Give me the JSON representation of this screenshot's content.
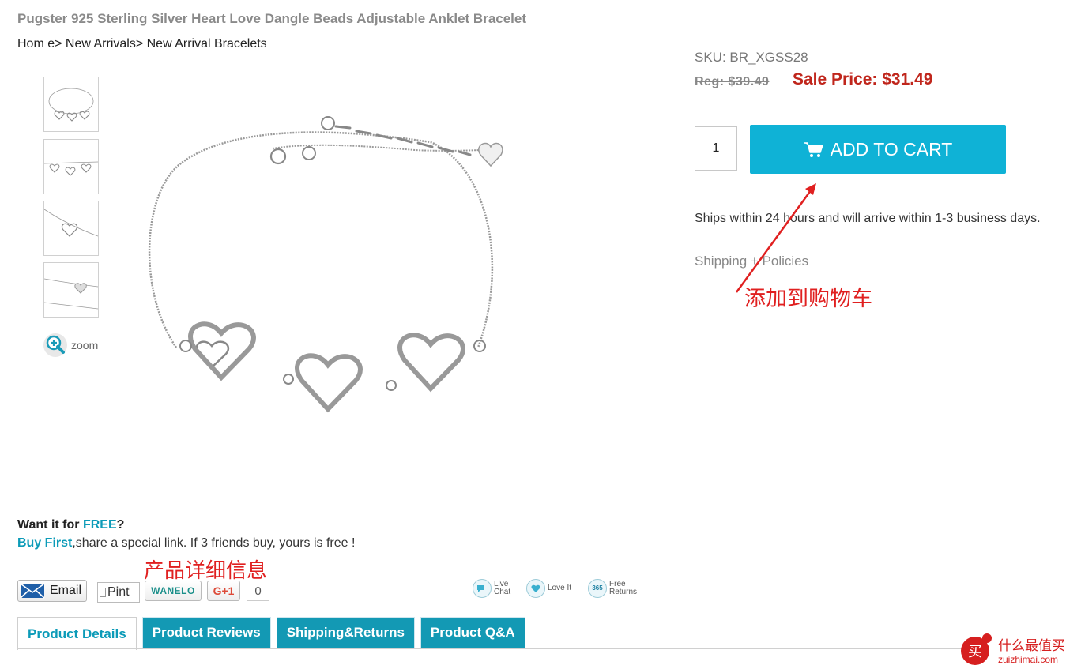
{
  "product": {
    "title": "Pugster 925 Sterling Silver Heart Love Dangle Beads Adjustable Anklet Bracelet",
    "sku": "SKU: BR_XGSS28",
    "reg_price": "Reg: $39.49",
    "sale_price": "Sale Price: $31.49"
  },
  "breadcrumb": {
    "items": [
      "Hom e",
      "New Arrivals",
      "New Arrival Bracelets"
    ],
    "sep": "> "
  },
  "gallery": {
    "zoom_label": "zoom"
  },
  "cart": {
    "quantity": "1",
    "add_label": "ADD TO CART",
    "accent": "#0fb2d6"
  },
  "shipping": {
    "note": "Ships within 24 hours and will arrive within 1-3 business days.",
    "policies_link": "Shipping + Policies"
  },
  "annotations": {
    "add_to_cart_cn": "添加到购物车",
    "product_details_cn": "产品详细信息",
    "color": "#e02020"
  },
  "free_offer": {
    "want_prefix": "Want it for ",
    "free_word": "FREE",
    "want_suffix": "?",
    "buy_first": "Buy First",
    "share_text": ",share a special link. If 3 friends buy, yours is free !"
  },
  "share": {
    "email_label": "Email",
    "pin_label": "Pint",
    "wanelo_label": "WANELO",
    "gplus_label": "G+1",
    "gplus_count": "0"
  },
  "features": [
    {
      "icon": "live-chat-icon",
      "line1": "Live",
      "line2": "Chat"
    },
    {
      "icon": "love-it-icon",
      "line1": "Love It",
      "line2": ""
    },
    {
      "icon": "free-returns-icon",
      "line1": "Free",
      "line2": "Returns"
    }
  ],
  "tabs": [
    {
      "label": "Product Details",
      "active": true
    },
    {
      "label": "Product Reviews",
      "active": false
    },
    {
      "label": "Shipping&Returns",
      "active": false
    },
    {
      "label": "Product Q&A",
      "active": false
    }
  ],
  "watermark": {
    "cn": "什么最值买",
    "domain": "zuizhimai.com",
    "badge": "买"
  }
}
